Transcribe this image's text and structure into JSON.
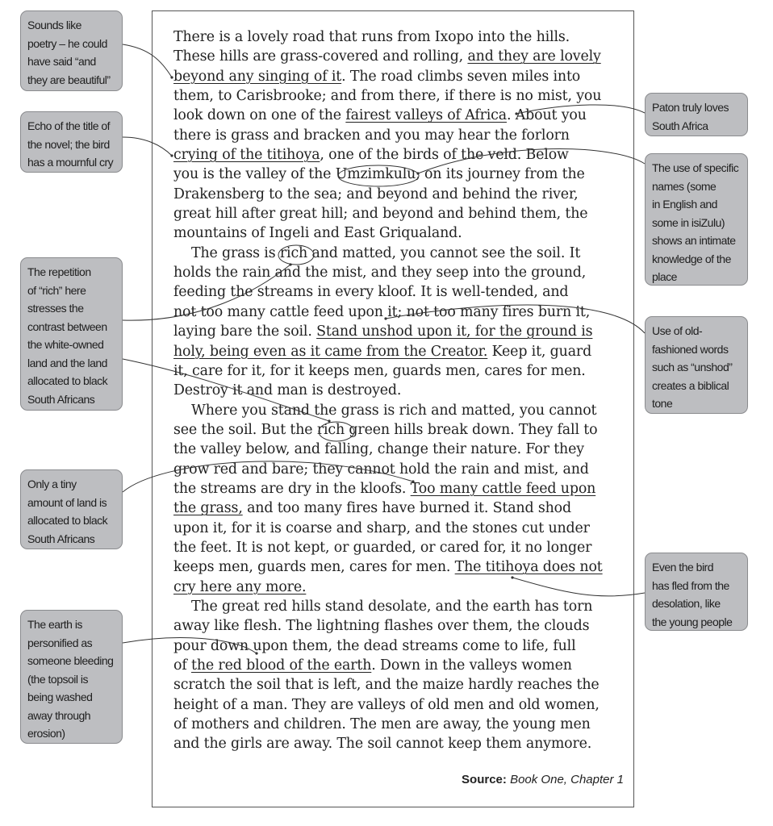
{
  "extract": {
    "lines": [
      {
        "indent": false,
        "segments": [
          {
            "t": "There is a lovely road that runs from Ixopo into the hills."
          }
        ]
      },
      {
        "indent": false,
        "segments": [
          {
            "t": "These hills are grass-covered and rolling, "
          },
          {
            "t": "and they are lovely",
            "u": true
          }
        ]
      },
      {
        "indent": false,
        "segments": [
          {
            "t": "beyond any singing of it",
            "u": true
          },
          {
            "t": ". The road climbs seven miles into"
          }
        ]
      },
      {
        "indent": false,
        "segments": [
          {
            "t": "them, to Carisbrooke; and from there, if there is no mist, you"
          }
        ]
      },
      {
        "indent": false,
        "segments": [
          {
            "t": "look down on one of the "
          },
          {
            "t": "fairest valleys of Africa",
            "u": true
          },
          {
            "t": ". About you"
          }
        ]
      },
      {
        "indent": false,
        "segments": [
          {
            "t": "there is grass and bracken and you may hear the forlorn"
          }
        ]
      },
      {
        "indent": false,
        "segments": [
          {
            "t": "crying of the titihoya",
            "u": true
          },
          {
            "t": ", one of the birds of the veld. Below"
          }
        ]
      },
      {
        "indent": false,
        "segments": [
          {
            "t": "you is the valley of the Umzimkulu, on its journey from the"
          }
        ]
      },
      {
        "indent": false,
        "segments": [
          {
            "t": "Drakensberg to the sea; and beyond and behind the river,"
          }
        ]
      },
      {
        "indent": false,
        "segments": [
          {
            "t": "great hill after great hill; and beyond and behind them, the"
          }
        ]
      },
      {
        "indent": false,
        "segments": [
          {
            "t": "mountains of Ingeli and East Griqualand."
          }
        ]
      },
      {
        "indent": true,
        "segments": [
          {
            "t": "The grass is rich and matted, you cannot see the soil. It"
          }
        ]
      },
      {
        "indent": false,
        "segments": [
          {
            "t": "holds the rain and the mist, and they seep into the ground,"
          }
        ]
      },
      {
        "indent": false,
        "segments": [
          {
            "t": "feeding the streams in every kloof. It is well-tended, and"
          }
        ]
      },
      {
        "indent": false,
        "segments": [
          {
            "t": "not too many cattle feed upon it; not too many fires burn it,"
          }
        ]
      },
      {
        "indent": false,
        "segments": [
          {
            "t": "laying bare the soil. "
          },
          {
            "t": "Stand unshod upon it, for the ground is",
            "u": true
          }
        ]
      },
      {
        "indent": false,
        "segments": [
          {
            "t": "holy, being even as it came from the Creator.",
            "u": true
          },
          {
            "t": " Keep it, guard"
          }
        ]
      },
      {
        "indent": false,
        "segments": [
          {
            "t": "it, care for it, for it keeps men, guards men, cares for men."
          }
        ]
      },
      {
        "indent": false,
        "segments": [
          {
            "t": "Destroy it and man is destroyed."
          }
        ]
      },
      {
        "indent": true,
        "segments": [
          {
            "t": "Where you stand the grass is rich and matted, you cannot"
          }
        ]
      },
      {
        "indent": false,
        "segments": [
          {
            "t": "see the soil. But the rich green hills break down. They fall to"
          }
        ]
      },
      {
        "indent": false,
        "segments": [
          {
            "t": "the valley below, and falling, change their nature. For they"
          }
        ]
      },
      {
        "indent": false,
        "segments": [
          {
            "t": "grow red and bare; they cannot hold the rain and mist, and"
          }
        ]
      },
      {
        "indent": false,
        "segments": [
          {
            "t": "the streams are dry in the kloofs. "
          },
          {
            "t": "Too many cattle feed upon",
            "u": true
          }
        ]
      },
      {
        "indent": false,
        "segments": [
          {
            "t": "the grass,",
            "u": true
          },
          {
            "t": " and too many fires have burned it. Stand shod"
          }
        ]
      },
      {
        "indent": false,
        "segments": [
          {
            "t": "upon it, for it is coarse and sharp, and the stones cut under"
          }
        ]
      },
      {
        "indent": false,
        "segments": [
          {
            "t": "the feet. It is not kept, or guarded, or cared for, it no longer"
          }
        ]
      },
      {
        "indent": false,
        "segments": [
          {
            "t": "keeps men, guards men, cares for men. "
          },
          {
            "t": "The titihoya does not",
            "u": true
          }
        ]
      },
      {
        "indent": false,
        "segments": [
          {
            "t": "cry here any more.",
            "u": true
          }
        ]
      },
      {
        "indent": true,
        "segments": [
          {
            "t": "The great red hills stand desolate, and the earth has torn"
          }
        ]
      },
      {
        "indent": false,
        "segments": [
          {
            "t": "away like flesh. The lightning flashes over them, the clouds"
          }
        ]
      },
      {
        "indent": false,
        "segments": [
          {
            "t": "pour down upon them, the dead streams come to life, full"
          }
        ]
      },
      {
        "indent": false,
        "segments": [
          {
            "t": "of "
          },
          {
            "t": "the red blood of the earth",
            "u": true
          },
          {
            "t": ". Down in the valleys women"
          }
        ]
      },
      {
        "indent": false,
        "segments": [
          {
            "t": "scratch the soil that is left, and the maize hardly reaches the"
          }
        ]
      },
      {
        "indent": false,
        "segments": [
          {
            "t": "height of a man. They are valleys of old men and old women,"
          }
        ]
      },
      {
        "indent": false,
        "segments": [
          {
            "t": "of mothers and children. The men are away, the young men"
          }
        ]
      },
      {
        "indent": false,
        "segments": [
          {
            "t": "and the girls are away. The soil cannot keep them anymore."
          }
        ]
      }
    ],
    "circled_words": [
      "Umzimkulu,",
      "rich",
      "rich"
    ],
    "source_label": "Source:",
    "source_value": "Book One, Chapter 1"
  },
  "callouts": {
    "left": [
      {
        "id": "sounds-like-poetry",
        "lines": [
          "Sounds like",
          "poetry – he could",
          "have said “and",
          "they are beautiful”"
        ]
      },
      {
        "id": "echo-of-title",
        "lines": [
          "Echo of the title of",
          "the novel; the bird",
          "has a mournful cry"
        ]
      },
      {
        "id": "repetition-of-rich",
        "lines": [
          "The repetition",
          "of “rich” here",
          "stresses the",
          "contrast between",
          "the white-owned",
          "land and the land",
          "allocated to black",
          "South Africans"
        ]
      },
      {
        "id": "tiny-amount-of-land",
        "lines": [
          "Only a tiny",
          "amount of land is",
          "allocated to black",
          "South Africans"
        ]
      },
      {
        "id": "earth-personified",
        "lines": [
          "The earth is",
          "personified as",
          "someone bleeding",
          "(the topsoil is",
          "being washed",
          "away through",
          "erosion)"
        ]
      }
    ],
    "right": [
      {
        "id": "paton-loves-sa",
        "lines": [
          "Paton truly loves",
          "South Africa"
        ]
      },
      {
        "id": "specific-names",
        "lines": [
          "The use of specific",
          "names (some",
          "in English and",
          "some in isiZulu)",
          "shows an intimate",
          "knowledge of the",
          "place"
        ]
      },
      {
        "id": "old-fashioned-words",
        "lines": [
          "Use of old-",
          "fashioned words",
          "such as “unshod”",
          "creates a biblical",
          "tone"
        ]
      },
      {
        "id": "bird-has-fled",
        "lines": [
          "Even the bird",
          "has fled from the",
          "desolation, like",
          "the young people"
        ]
      }
    ]
  },
  "colors": {
    "callout_fill": "#bdbec1",
    "callout_border": "#8a8b8e",
    "text": "#222222",
    "connector": "#333333"
  }
}
